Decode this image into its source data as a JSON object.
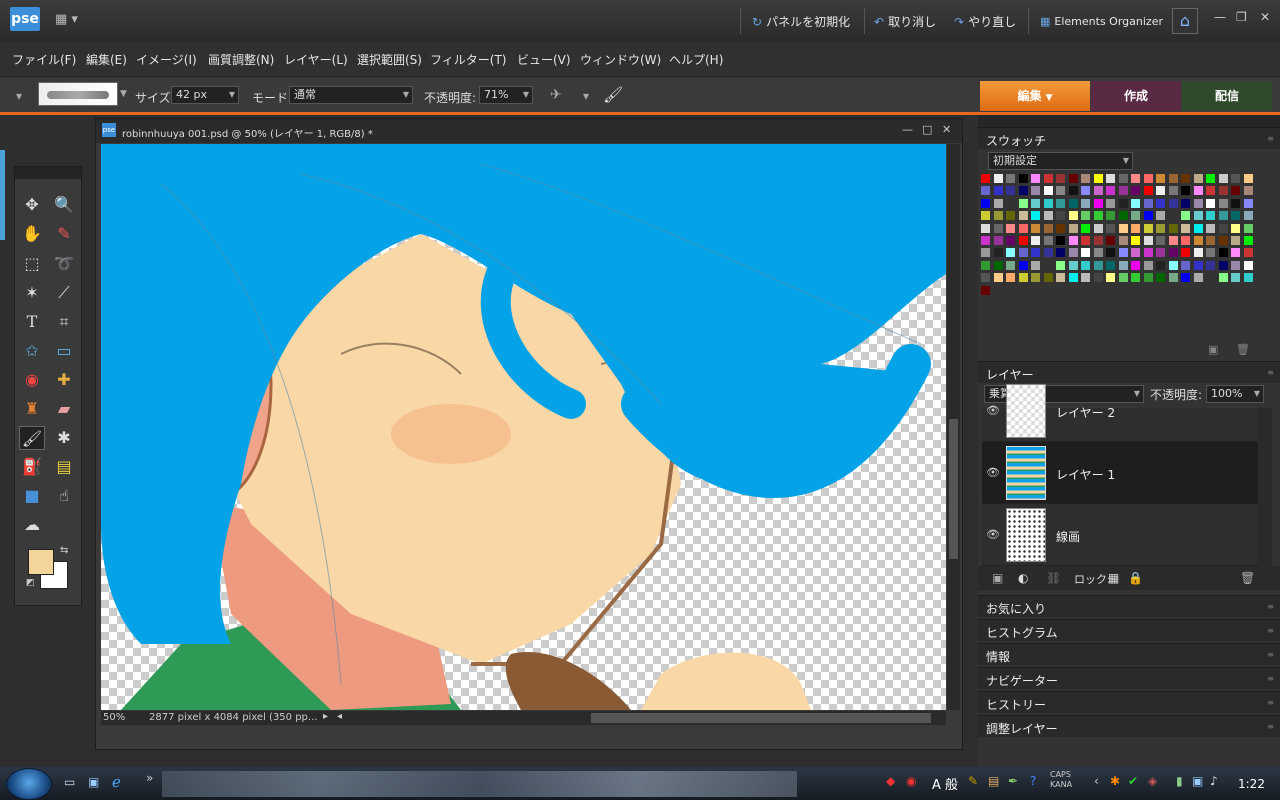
{
  "titlebar": {
    "logo": "pse",
    "reset_panels": "パネルを初期化",
    "undo": "取り消し",
    "redo": "やり直し",
    "organizer": "Elements Organizer"
  },
  "menu": [
    "ファイル(F)",
    "編集(E)",
    "イメージ(I)",
    "画質調整(N)",
    "レイヤー(L)",
    "選択範囲(S)",
    "フィルター(T)",
    "ビュー(V)",
    "ウィンドウ(W)",
    "ヘルプ(H)"
  ],
  "options": {
    "size_label": "サイズ:",
    "size_value": "42 px",
    "mode_label": "モード:",
    "mode_value": "通常",
    "opacity_label": "不透明度:",
    "opacity_value": "71%"
  },
  "mode_tabs": [
    {
      "label": "編集",
      "color": "#e8761e"
    },
    {
      "label": "作成",
      "color": "#5a2a44"
    },
    {
      "label": "配信",
      "color": "#2e4a2a"
    }
  ],
  "document": {
    "title": "robinnhuuya 001.psd @ 50% (レイヤー 1, RGB/8) *",
    "zoom": "50%",
    "dimensions": "2877 pixel x 4084 pixel (350 pp..."
  },
  "swatches": {
    "title": "スウォッチ",
    "preset": "初期設定"
  },
  "layers_panel": {
    "title": "レイヤー",
    "blend_mode": "乗算",
    "opacity_label": "不透明度:",
    "opacity_value": "100%",
    "lock_label": "ロック:",
    "layers": [
      {
        "name": "レイヤー 2"
      },
      {
        "name": "レイヤー 1"
      },
      {
        "name": "線画"
      }
    ]
  },
  "collapsed_panels": [
    "お気に入り",
    "ヒストグラム",
    "情報",
    "ナビゲーター",
    "ヒストリー",
    "調整レイヤー"
  ],
  "taskbar": {
    "clock": "1:22",
    "ime": "A 般",
    "caps": "CAPS",
    "kana": "KANA"
  }
}
